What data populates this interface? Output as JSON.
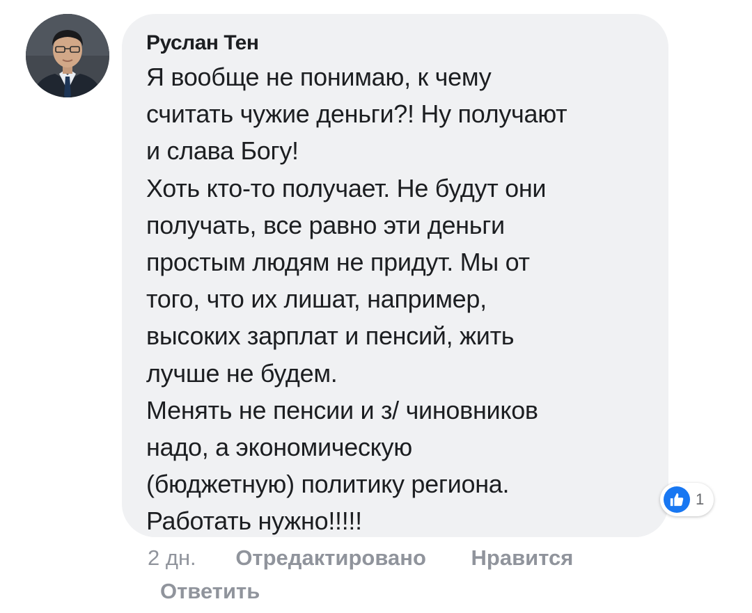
{
  "comment": {
    "author": "Руслан Тен",
    "avatar_icon": "person-photo",
    "lines": [
      "Я вообще не понимаю, к чему",
      "считать чужие деньги?! Ну получают",
      "и слава Богу!",
      "Хоть кто-то получает. Не будут они",
      "получать, все равно эти деньги",
      "простым людям не придут. Мы от",
      "того, что их лишат, например,",
      "высоких зарплат и пенсий, жить",
      "лучше не будем.",
      "Менять не пенсии и з/ чиновников",
      "надо, а экономическую",
      "(бюджетную) политику региона.",
      "Работать нужно!!!!!"
    ],
    "reaction": {
      "icon": "thumbs-up-icon",
      "count": "1",
      "color": "#1877f2"
    },
    "meta": {
      "time": "2 дн.",
      "edited_label": "Отредактировано",
      "like_label": "Нравится",
      "reply_label": "Ответить"
    }
  },
  "colors": {
    "bubble_bg": "#f0f1f3",
    "text": "#1c1e21",
    "meta": "#90949c"
  }
}
